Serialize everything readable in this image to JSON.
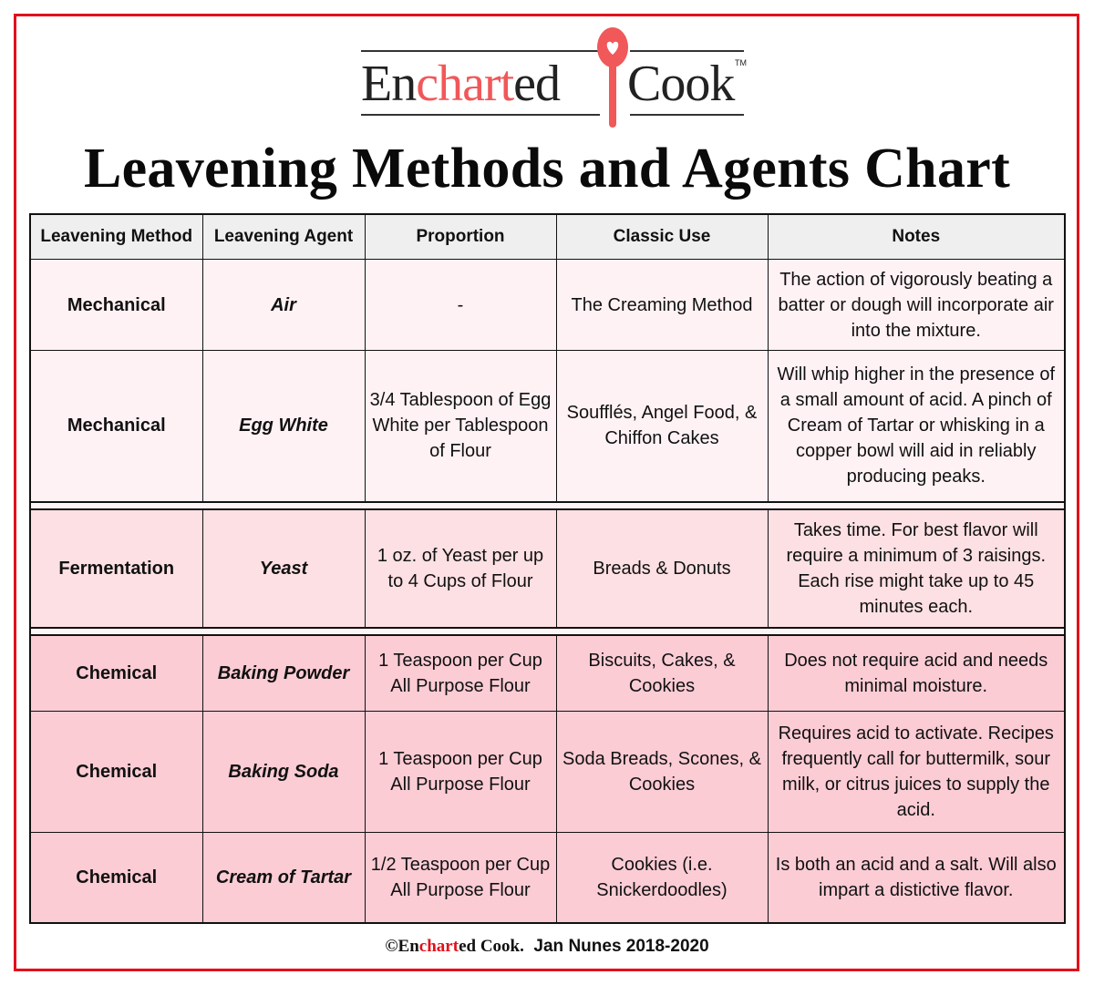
{
  "logo": {
    "part1_prefix": "En",
    "part1_highlight": "chart",
    "part1_suffix": "ed",
    "part2": "Cook",
    "trademark": "TM",
    "icon": "spoon-heart-icon",
    "accent_color": "#f0585a"
  },
  "title": "Leavening Methods and Agents Chart",
  "table": {
    "headers": [
      "Leavening Method",
      "Leavening Agent",
      "Proportion",
      "Classic Use",
      "Notes"
    ],
    "rows": [
      {
        "method": "Mechanical",
        "agent": "Air",
        "proportion": "-",
        "classic_use": "The Creaming Method",
        "notes": "The action of vigorously beating a batter or dough will incorporate air into the mixture."
      },
      {
        "method": "Mechanical",
        "agent": "Egg White",
        "proportion": "3/4 Tablespoon of Egg White per Tablespoon of Flour",
        "classic_use": "Soufflés, Angel Food, & Chiffon Cakes",
        "notes": "Will whip higher in the presence of a small amount of acid.  A pinch of Cream of Tartar or whisking in a copper bowl will aid in reliably producing peaks."
      },
      {
        "method": "Fermentation",
        "agent": "Yeast",
        "proportion": "1 oz. of Yeast per up to 4 Cups of Flour",
        "classic_use": "Breads & Donuts",
        "notes": "Takes time. For best flavor will require a minimum of 3 raisings. Each rise might take up to 45 minutes each."
      },
      {
        "method": "Chemical",
        "agent": "Baking Powder",
        "proportion": "1 Teaspoon per Cup All Purpose Flour",
        "classic_use": "Biscuits, Cakes, & Cookies",
        "notes": "Does not require acid and needs minimal moisture."
      },
      {
        "method": "Chemical",
        "agent": "Baking Soda",
        "proportion": "1 Teaspoon per Cup All Purpose Flour",
        "classic_use": "Soda Breads, Scones, & Cookies",
        "notes": "Requires acid to activate. Recipes frequently call for buttermilk, sour milk, or citrus juices to supply the acid."
      },
      {
        "method": "Chemical",
        "agent": "Cream of Tartar",
        "proportion": "1/2 Teaspoon per Cup All Purpose Flour",
        "classic_use": "Cookies (i.e. Snickerdoodles)",
        "notes": "Is both an acid and a salt. Will also impart a distictive flavor."
      }
    ],
    "group_colors": {
      "mechanical": "#fff2f4",
      "fermentation": "#fde0e3",
      "chemical": "#fcccd5",
      "header": "#efefef"
    }
  },
  "footer": {
    "copyright": "©",
    "brand_prefix": "En",
    "brand_highlight": "chart",
    "brand_suffix": "ed Cook.",
    "author": "Jan Nunes 2018-2020"
  },
  "frame_color": "#e3101a"
}
